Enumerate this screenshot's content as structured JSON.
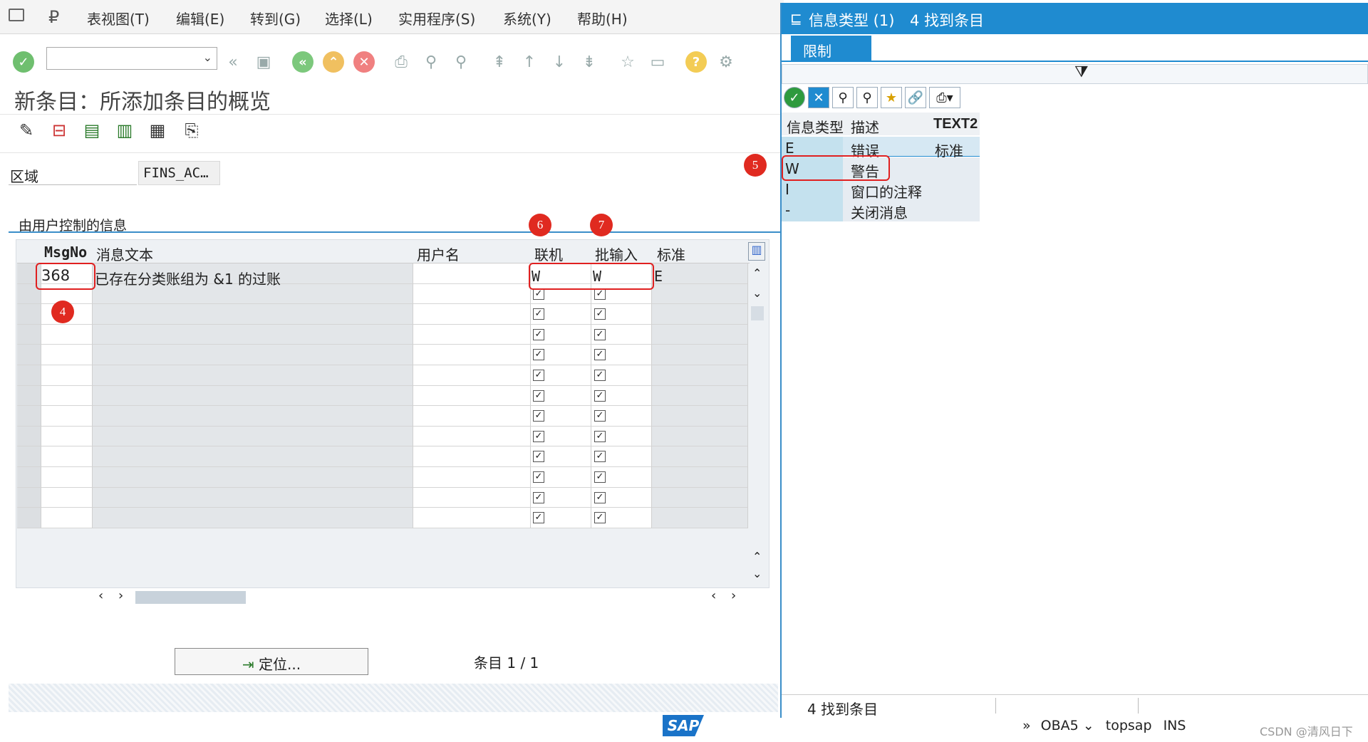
{
  "menu": {
    "items": [
      "表视图(T)",
      "编辑(E)",
      "转到(G)",
      "选择(L)",
      "实用程序(S)",
      "系统(Y)",
      "帮助(H)"
    ]
  },
  "toolbar": {
    "command_value": ""
  },
  "page": {
    "title": "新条目：所添加条目的概览",
    "area_label": "区域",
    "area_value": "FINS_AC…"
  },
  "group": {
    "title": "由用户控制的信息"
  },
  "table": {
    "columns": [
      "MsgNo",
      "消息文本",
      "用户名",
      "联机",
      "批输入",
      "标准"
    ],
    "row": {
      "msgno": "368",
      "text": "已存在分类账组为 &1 的过账",
      "user": "",
      "online": "W",
      "batch": "W",
      "standard": "E"
    },
    "empty_rows": 12
  },
  "footer": {
    "locate_button": "定位...",
    "entries_label": "条目 1 / 1"
  },
  "badges": [
    "4",
    "5",
    "6",
    "7"
  ],
  "popup": {
    "title": "信息类型 (1)",
    "found": "4 找到条目",
    "tab": "限制",
    "columns": [
      "信息类型",
      "描述",
      "TEXT2"
    ],
    "rows": [
      {
        "type": "E",
        "desc": "错误",
        "text2": "标准"
      },
      {
        "type": "W",
        "desc": "警告",
        "text2": ""
      },
      {
        "type": "I",
        "desc": "窗口的注释",
        "text2": ""
      },
      {
        "type": "-",
        "desc": "关闭消息",
        "text2": ""
      }
    ],
    "status": "4 找到条目"
  },
  "statusbar": {
    "logo": "SAP",
    "tcode": "OBA5",
    "server": "topsap",
    "mode": "INS",
    "watermark": "CSDN @清风日下"
  },
  "colors": {
    "accent": "#1f8bd0",
    "highlight": "#e02020",
    "selected_row": "#d6e8f3"
  }
}
